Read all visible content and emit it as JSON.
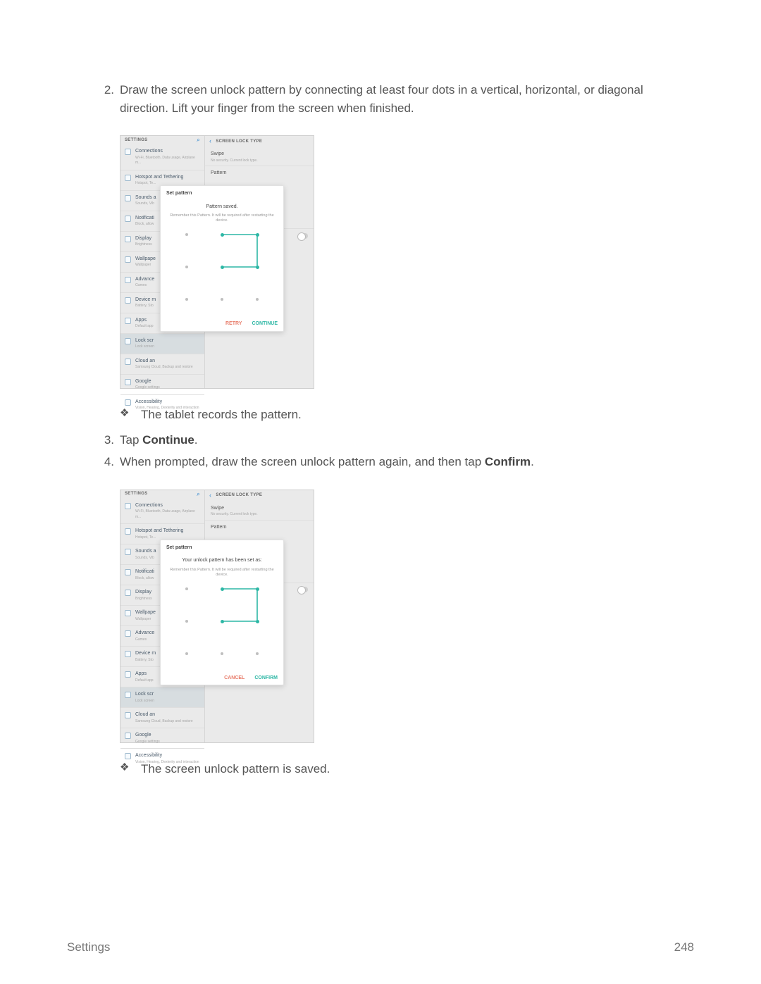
{
  "steps": {
    "s2": {
      "num": "2.",
      "text_a": "Draw the screen unlock pattern by connecting at least four dots in a vertical, horizontal, or diagonal direction. Lift your finger from the screen when finished."
    },
    "bullet_a": "The tablet records the pattern.",
    "s3": {
      "num": "3.",
      "prefix": "Tap ",
      "bold": "Continue",
      "suffix": "."
    },
    "s4": {
      "num": "4.",
      "prefix": "When prompted, draw the screen unlock pattern again, and then tap ",
      "bold": "Confirm",
      "suffix": "."
    },
    "bullet_b": "The screen unlock pattern is saved."
  },
  "fig": {
    "settings_hdr": "SETTINGS",
    "right_hdr": "SCREEN LOCK TYPE",
    "side": [
      {
        "title": "Connections",
        "sub": "Wi-Fi, Bluetooth, Data usage, Airplane m..."
      },
      {
        "title": "Hotspot and Tethering",
        "sub": "Hotspot, Te..."
      },
      {
        "title": "Sounds a",
        "sub": "Sounds, Vib"
      },
      {
        "title": "Notificati",
        "sub": "Block, allow"
      },
      {
        "title": "Display",
        "sub": "Brightness"
      },
      {
        "title": "Wallpape",
        "sub": "Wallpaper"
      },
      {
        "title": "Advance",
        "sub": "Games"
      },
      {
        "title": "Device m",
        "sub": "Battery, Sto"
      },
      {
        "title": "Apps",
        "sub": "Default app"
      },
      {
        "title": "Lock scr",
        "sub": "Lock screen"
      },
      {
        "title": "Cloud an",
        "sub": "Samsung Cloud, Backup and restore"
      },
      {
        "title": "Google",
        "sub": "Google settings"
      },
      {
        "title": "Accessibility",
        "sub": "Vision, Hearing, Dexterity and interaction"
      }
    ],
    "right_rows": {
      "swipe_title": "Swipe",
      "swipe_sub": "No security. Current lock type.",
      "pattern_title": "Pattern"
    },
    "modal1": {
      "title": "Set pattern",
      "msg": "Pattern saved.",
      "note": "Remember this Pattern. It will be required after restarting the device.",
      "btn_retry": "RETRY",
      "btn_continue": "CONTINUE"
    },
    "modal2": {
      "title": "Set pattern",
      "msg": "Your unlock pattern has been set as:",
      "note": "Remember this Pattern. It will be required after restarting the device.",
      "btn_cancel": "CANCEL",
      "btn_confirm": "CONFIRM"
    }
  },
  "footer": {
    "left": "Settings",
    "right": "248"
  }
}
